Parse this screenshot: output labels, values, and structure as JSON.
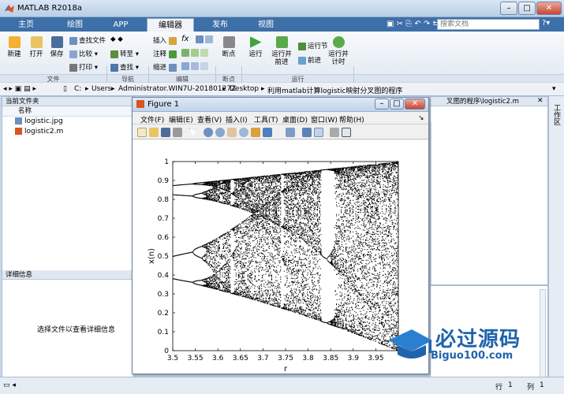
{
  "window": {
    "title": "MATLAB R2018a"
  },
  "tabs": [
    "主页",
    "绘图",
    "APP",
    "编辑器",
    "发布",
    "视图"
  ],
  "search": {
    "placeholder": "搜索文档"
  },
  "ribbon": {
    "file_group": {
      "label": "文件",
      "new": "新建",
      "open": "打开",
      "save": "保存",
      "find_files": "查找文件",
      "compare": "比较",
      "print": "打印"
    },
    "nav_group": {
      "label": "导航",
      "goto": "转至",
      "find": "查找"
    },
    "edit_group": {
      "label": "编辑",
      "insert": "插入",
      "comment": "注释",
      "indent": "缩进",
      "fx": "fx"
    },
    "breakpoint_group": {
      "label": "断点",
      "breakpoints": "断点"
    },
    "run_group": {
      "label": "运行",
      "run": "运行",
      "run_advance": "运行并\n前进",
      "run_section": "运行节",
      "advance": "前进",
      "run_time": "运行并\n计时"
    }
  },
  "address": {
    "parts": [
      "C:",
      "Users",
      "Administrator.WIN7U-20180127Z",
      "Desktop",
      "利用matlab计算logistic映射分叉图的程序"
    ]
  },
  "current_folder": {
    "header": "当前文件夹",
    "column": "名称",
    "files": [
      "logistic.jpg",
      "logistic2.m"
    ]
  },
  "details": {
    "header": "详细信息",
    "empty_text": "选择文件以查看详细信息"
  },
  "right_panel": {
    "path_fragment": "叉图的程序\\logistic2.m"
  },
  "status": {
    "row_label": "行",
    "row": "1",
    "col_label": "列",
    "col": "1"
  },
  "side_strip": {
    "label": "工作区"
  },
  "figure": {
    "title": "Figure 1",
    "menu": [
      "文件(F)",
      "编辑(E)",
      "查看(V)",
      "插入(I)",
      "工具(T)",
      "桌面(D)",
      "窗口(W)",
      "帮助(H)"
    ]
  },
  "watermark": {
    "brand": "必过源码",
    "url": "Biguo100.com"
  },
  "chart_data": {
    "type": "scatter",
    "title": "",
    "xlabel": "r",
    "ylabel": "x(n)",
    "xlim": [
      3.5,
      4.0
    ],
    "ylim": [
      0,
      1
    ],
    "xticks": [
      3.5,
      3.55,
      3.6,
      3.65,
      3.7,
      3.75,
      3.8,
      3.85,
      3.9,
      3.95
    ],
    "yticks": [
      0,
      0.1,
      0.2,
      0.3,
      0.4,
      0.5,
      0.6,
      0.7,
      0.8,
      0.9,
      1
    ],
    "grid": false,
    "series": [
      {
        "values_description_model": "logistic",
        "r_range": [
          3.5,
          4.0
        ],
        "marker_color": "#000000"
      }
    ]
  },
  "colors": {
    "accent": "#3d6fa8",
    "panel_border": "#a9bbd3"
  }
}
